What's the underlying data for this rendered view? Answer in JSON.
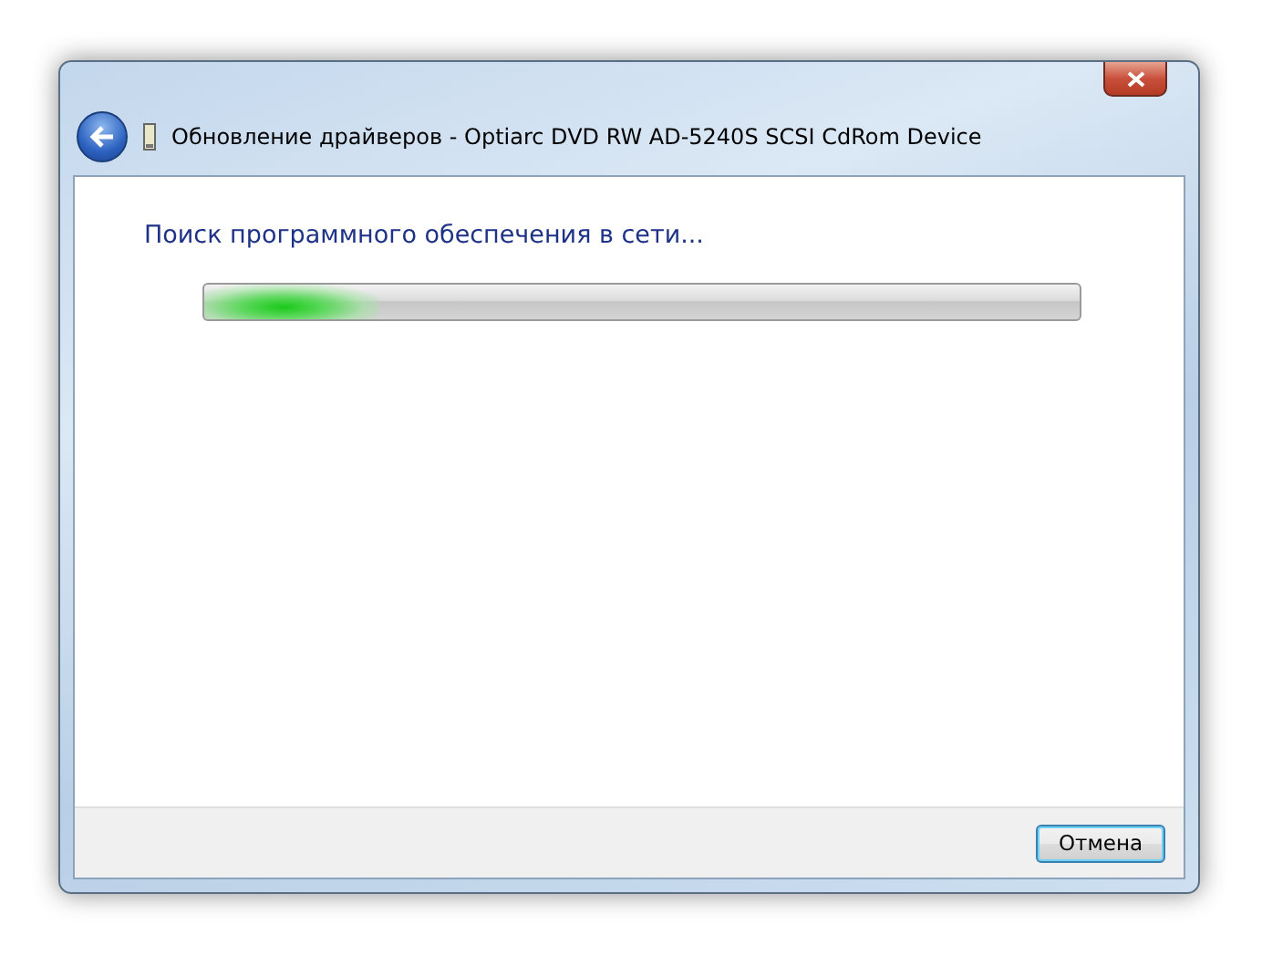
{
  "window": {
    "title": "Обновление драйверов - Optiarc DVD RW AD-5240S SCSI CdRom Device"
  },
  "heading": "Поиск программного обеспечения в сети...",
  "progress": {
    "level": 0.2
  },
  "buttons": [
    {
      "label": "Отмена",
      "focused": true
    }
  ]
}
